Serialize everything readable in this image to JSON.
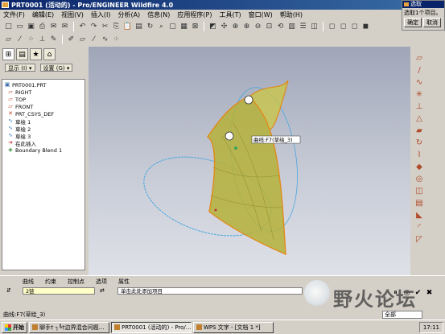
{
  "window": {
    "title": "PRT0001 (活动的) - Pro/ENGINEER Wildfire 4.0"
  },
  "menu": [
    "文件(F)",
    "编辑(E)",
    "视图(V)",
    "插入(I)",
    "分析(A)",
    "信息(N)",
    "应用程序(P)",
    "工具(T)",
    "窗口(W)",
    "帮助(H)"
  ],
  "selection_dialog": {
    "title": "选取",
    "message": "选取1个项目。",
    "ok_label": "确定",
    "cancel_label": "取消"
  },
  "panel": {
    "show_label": "显示 (I) ▾",
    "settings_label": "设置 (G) ▾"
  },
  "model_tree": [
    {
      "icon": "part-icon",
      "label": "PRT0001.PRT",
      "indent": false
    },
    {
      "icon": "datum-plane-icon",
      "label": "RIGHT",
      "indent": true
    },
    {
      "icon": "datum-plane-icon",
      "label": "TOP",
      "indent": true
    },
    {
      "icon": "datum-plane-icon",
      "label": "FRONT",
      "indent": true
    },
    {
      "icon": "csys-icon",
      "label": "PRT_CSYS_DEF",
      "indent": true
    },
    {
      "icon": "sketch-icon",
      "label": "草绘 1",
      "indent": true
    },
    {
      "icon": "sketch-icon",
      "label": "草绘 2",
      "indent": true
    },
    {
      "icon": "sketch-icon",
      "label": "草绘 3",
      "indent": true
    },
    {
      "icon": "insert-here-icon",
      "label": "在此插入",
      "indent": true
    },
    {
      "icon": "boundary-blend-icon",
      "label": "Boundary Blend 1",
      "indent": true
    }
  ],
  "viewport": {
    "curve_label": "曲线:F7(草绘_3)"
  },
  "dashboard": {
    "tabs": [
      "曲线",
      "约束",
      "控制点",
      "选项",
      "属性"
    ],
    "chain_count": "2链",
    "add_item_hint": "单击此处添加项目"
  },
  "watermark": "野火论坛",
  "statusbar": {
    "message": "曲线:F7(草绘_3)",
    "filter": "全部"
  },
  "taskbar": {
    "start_label": "开始",
    "items": [
      "聊手† ┐╚†边界混合问题…",
      "PRT0001 (活动的) - Pro/…",
      "WPS 文字 - [文档 1 *]"
    ],
    "active_index": 1,
    "time": "17:11"
  },
  "colors": {
    "surface": "#b5b23a",
    "edge": "#e08a1a",
    "curve": "#4aa7e0",
    "titlebar": "#0a246a"
  }
}
